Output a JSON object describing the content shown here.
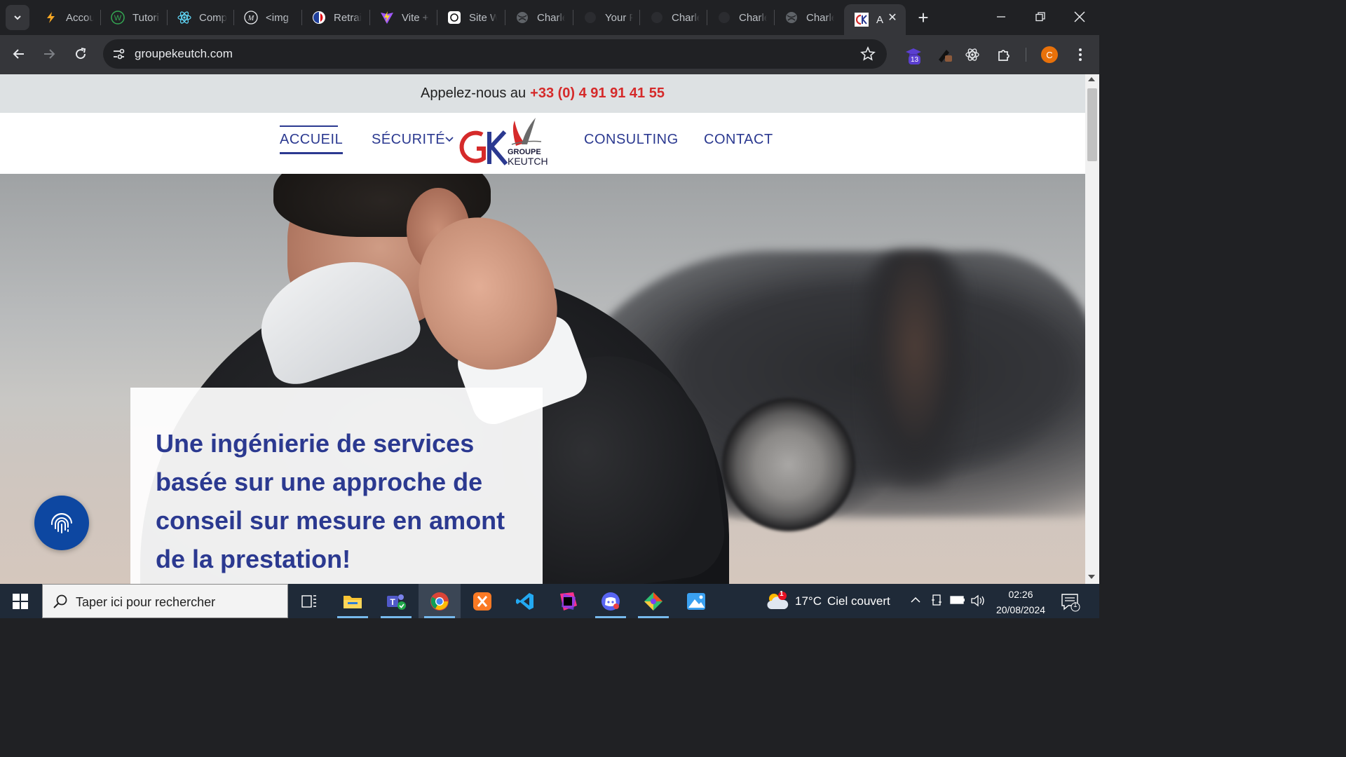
{
  "browser": {
    "tabs": [
      {
        "label": "Accou",
        "icon": "bolt-icon"
      },
      {
        "label": "Tutori",
        "icon": "w-icon"
      },
      {
        "label": "Comp",
        "icon": "react-icon"
      },
      {
        "label": "<img",
        "icon": "m-icon"
      },
      {
        "label": "Retrai",
        "icon": "flag-icon"
      },
      {
        "label": "Vite +",
        "icon": "vite-icon"
      },
      {
        "label": "Site W",
        "icon": "openai-icon"
      },
      {
        "label": "Charle",
        "icon": "globe-icon"
      },
      {
        "label": "Your F",
        "icon": "github-icon"
      },
      {
        "label": "Charle",
        "icon": "github-icon"
      },
      {
        "label": "Charle",
        "icon": "github-icon"
      },
      {
        "label": "Charle",
        "icon": "globe-icon"
      },
      {
        "label": "A",
        "icon": "gk-icon",
        "active": true
      }
    ],
    "url": "groupekeutch.com",
    "extension_badge": "13",
    "profile_initial": "C"
  },
  "site": {
    "topbar": {
      "prefix": "Appelez-nous au",
      "phone": "+33 (0) 4 91 91 41 55"
    },
    "nav": {
      "home": "ACCUEIL",
      "security": "SÉCURITÉ",
      "consulting": "CONSULTING",
      "contact": "CONTACT"
    },
    "logo": {
      "line1": "GROUPE",
      "line2": "KEUTCH",
      "letters": "GK"
    },
    "hero": {
      "headline": "Une ingénierie de services basée sur une approche de conseil sur mesure en amont de la prestation!"
    }
  },
  "taskbar": {
    "search_placeholder": "Taper ici pour rechercher",
    "weather": {
      "temp": "17°C",
      "condition": "Ciel couvert",
      "alert_count": "1"
    },
    "clock": {
      "time": "02:26",
      "date": "20/08/2024"
    },
    "notification_count": "1"
  },
  "colors": {
    "brand_blue": "#2b3990",
    "phone_red": "#d52a2a",
    "logo_red": "#d52a2a"
  }
}
